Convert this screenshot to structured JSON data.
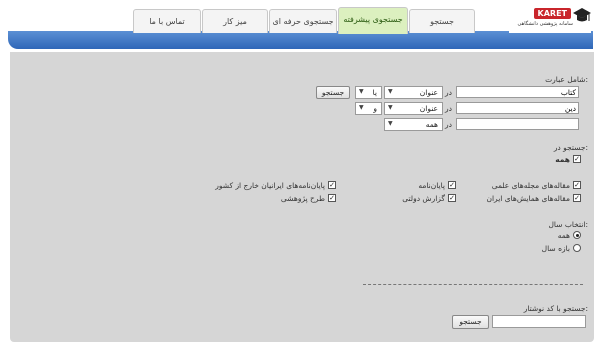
{
  "logo": {
    "name": "KARET",
    "tagline": "سامانه پژوهشی دانشگاهی"
  },
  "tabs": [
    {
      "label": "جستجو",
      "active": false
    },
    {
      "label": "جستجوی پیشرفته",
      "active": true
    },
    {
      "label": "جستجوی حرفه ای",
      "active": false
    },
    {
      "label": "میز کار",
      "active": false
    },
    {
      "label": "تماس با ما",
      "active": false
    }
  ],
  "form": {
    "contains_label": "شامل عبارت:",
    "in_word": "در",
    "rows": [
      {
        "term": "کتاب",
        "field": "عنوان",
        "operator": "یا"
      },
      {
        "term": "دین",
        "field": "عنوان",
        "operator": "و"
      },
      {
        "term": "",
        "field": "همه"
      }
    ],
    "search_button": "جستجو",
    "search_in_label": "جستجو در:",
    "all_label": "همه",
    "sources": [
      {
        "label": "مقاله‌های مجله‌های علمی",
        "checked": true
      },
      {
        "label": "پایان‌نامه",
        "checked": true
      },
      {
        "label": "پایان‌نامه‌های ایرانیان خارج از کشور",
        "checked": true
      },
      {
        "label": "مقاله‌های همایش‌های ایران",
        "checked": true
      },
      {
        "label": "گزارش دولتی",
        "checked": true
      },
      {
        "label": "طرح پژوهشی",
        "checked": true
      }
    ],
    "year_label": "انتخاب سال:",
    "year_options": [
      {
        "label": "همه",
        "selected": true
      },
      {
        "label": "بازه سال",
        "selected": false
      }
    ],
    "author_code_label": "جستجو با کد نوشتار:",
    "author_code_value": "",
    "author_search_button": "جستجو"
  }
}
